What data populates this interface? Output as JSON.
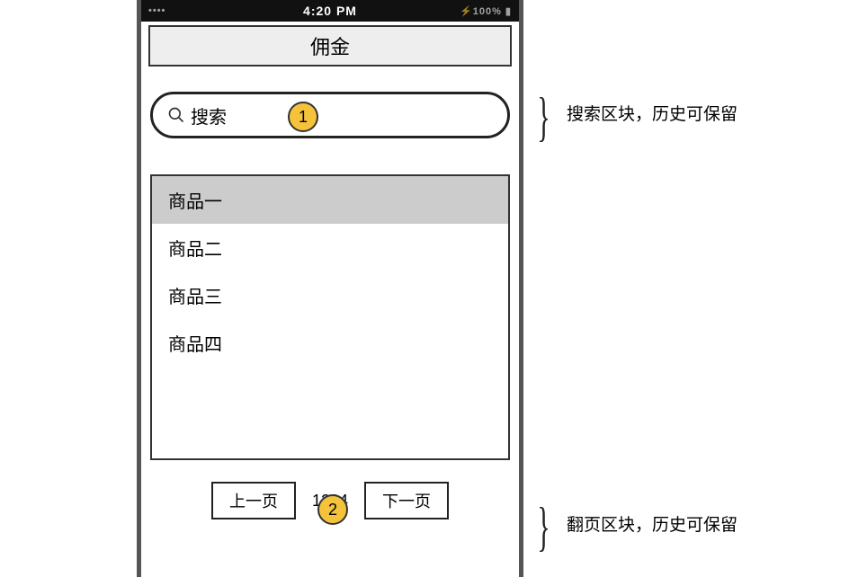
{
  "status_bar": {
    "carrier": "••••",
    "time": "4:20 PM",
    "right": "⚡100% ▮"
  },
  "nav": {
    "title": "佣金"
  },
  "search": {
    "placeholder": "搜索"
  },
  "list": {
    "items": [
      {
        "label": "商品一",
        "selected": true
      },
      {
        "label": "商品二",
        "selected": false
      },
      {
        "label": "商品三",
        "selected": false
      },
      {
        "label": "商品四",
        "selected": false
      }
    ]
  },
  "pager": {
    "prev": "上一页",
    "next": "下一页",
    "info": "1234"
  },
  "markers": {
    "m1": "1",
    "m2": "2"
  },
  "annotations": {
    "a1": "搜索区块，历史可保留",
    "a2": "翻页区块，历史可保留"
  }
}
